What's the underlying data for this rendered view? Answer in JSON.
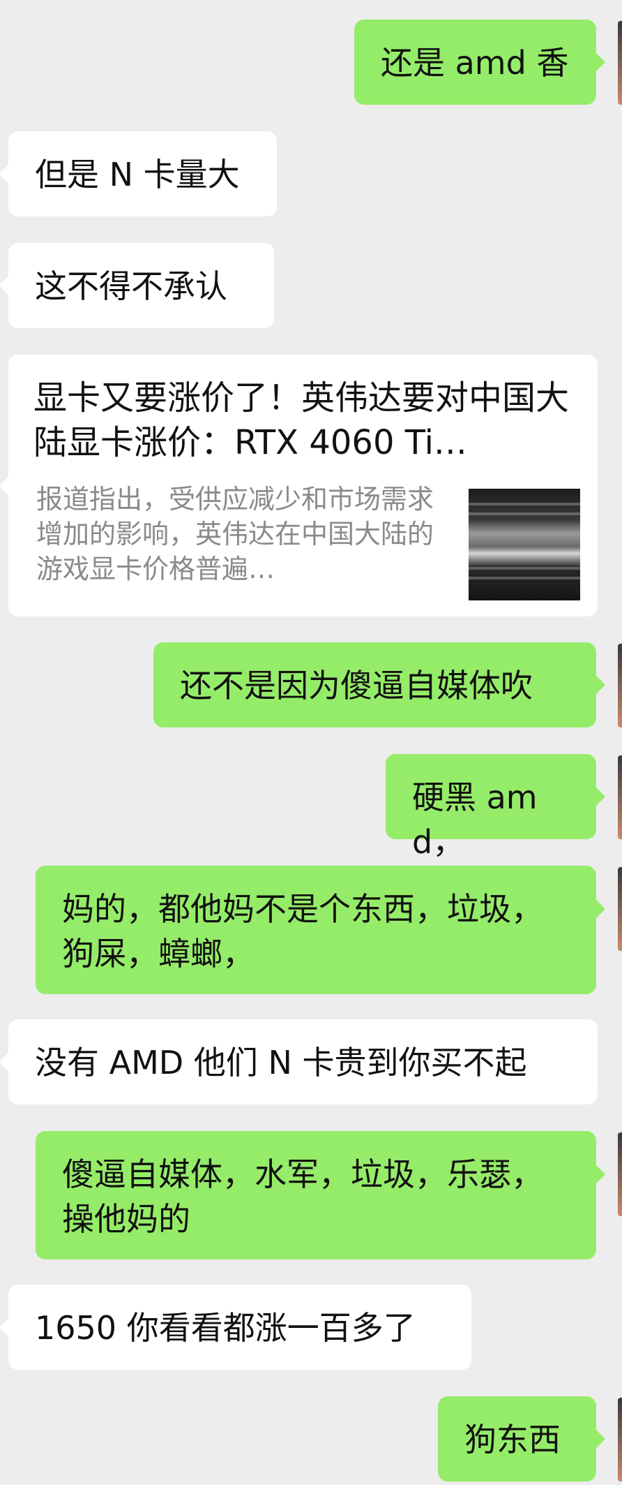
{
  "messages": [
    {
      "side": "out",
      "text": "还是 amd 香"
    },
    {
      "side": "in",
      "text": "但是 N 卡量大"
    },
    {
      "side": "in",
      "text": "这不得不承认"
    },
    {
      "side": "in",
      "type": "link-card",
      "title": "显卡又要涨价了！英伟达要对中国大陆显卡涨价：RTX 4060 Ti…",
      "description": "报道指出，受供应减少和市场需求增加的影响，英伟达在中国大陆的游戏显卡价格普遍…"
    },
    {
      "side": "out",
      "text": "还不是因为傻逼自媒体吹"
    },
    {
      "side": "out",
      "text": "硬黑 amd，"
    },
    {
      "side": "out",
      "text": "妈的，都他妈不是个东西，垃圾，狗屎，蟑螂，"
    },
    {
      "side": "in",
      "text": "没有 AMD 他们 N 卡贵到你买不起"
    },
    {
      "side": "out",
      "text": "傻逼自媒体，水军，垃圾，乐瑟，操他妈的"
    },
    {
      "side": "in",
      "text": "1650 你看看都涨一百多了"
    },
    {
      "side": "out",
      "text": "狗东西"
    }
  ],
  "colors": {
    "background": "#ededed",
    "outgoing_bubble": "#95ec69",
    "incoming_bubble": "#ffffff"
  }
}
